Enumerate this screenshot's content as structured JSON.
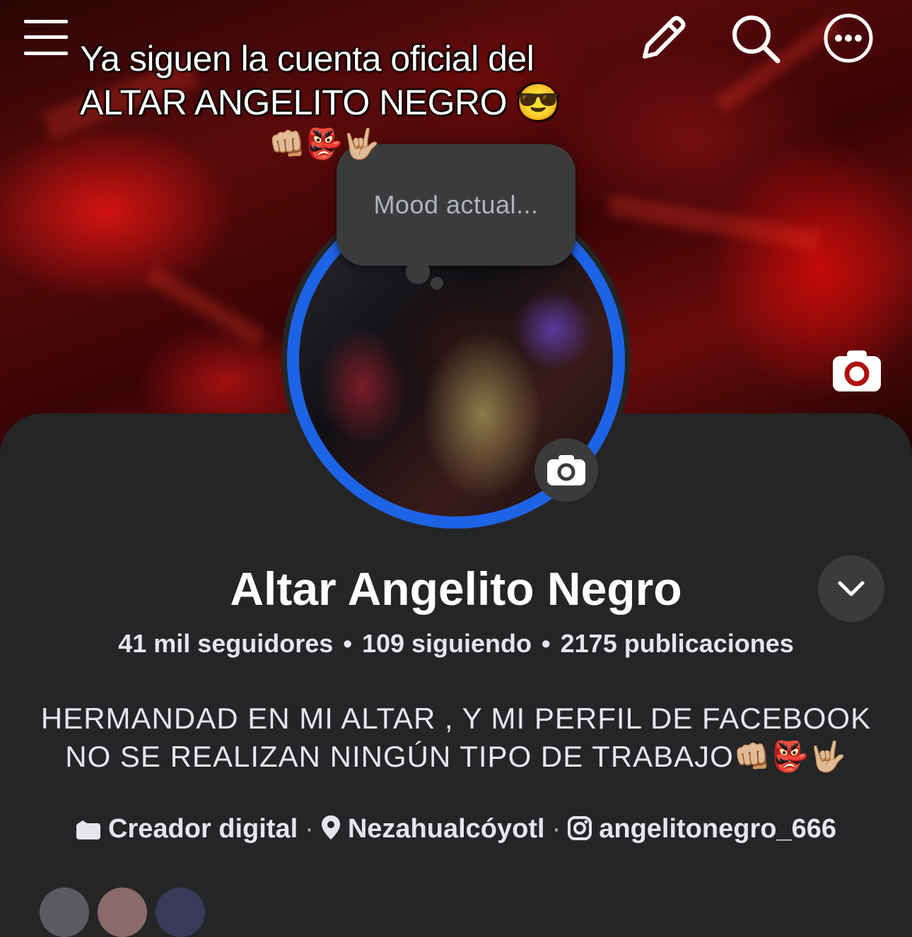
{
  "overlay_caption": {
    "line1": "Ya siguen la cuenta oficial del",
    "line2": "ALTAR ANGELITO NEGRO 😎",
    "emojis": "👊🏼👺🤟🏼"
  },
  "top_bar": {
    "icons": [
      "menu-icon",
      "edit-pencil-icon",
      "search-icon",
      "more-options-icon"
    ]
  },
  "mood_bubble": {
    "placeholder": "Mood actual..."
  },
  "profile": {
    "name": "Altar Angelito Negro",
    "followers": "41 mil seguidores",
    "following": "109 siguiendo",
    "posts": "2175 publicaciones",
    "separator": "•",
    "bio_line1": "HERMANDAD EN MI ALTAR , Y MI PERFIL DE FACEBOOK",
    "bio_line2": "NO SE REALIZAN NINGÚN TIPO DE TRABAJO👊🏼👺🤟🏼",
    "category": "Creador digital",
    "location": "Nezahualcóyotl",
    "instagram": "angelitonegro_666",
    "detail_separator": "·"
  },
  "colors": {
    "panel_bg": "#242526",
    "ring_blue": "#1d63e6",
    "button_bg": "#3a3b3c",
    "text_primary": "#e4e6eb",
    "text_secondary": "#b0b3b8"
  }
}
